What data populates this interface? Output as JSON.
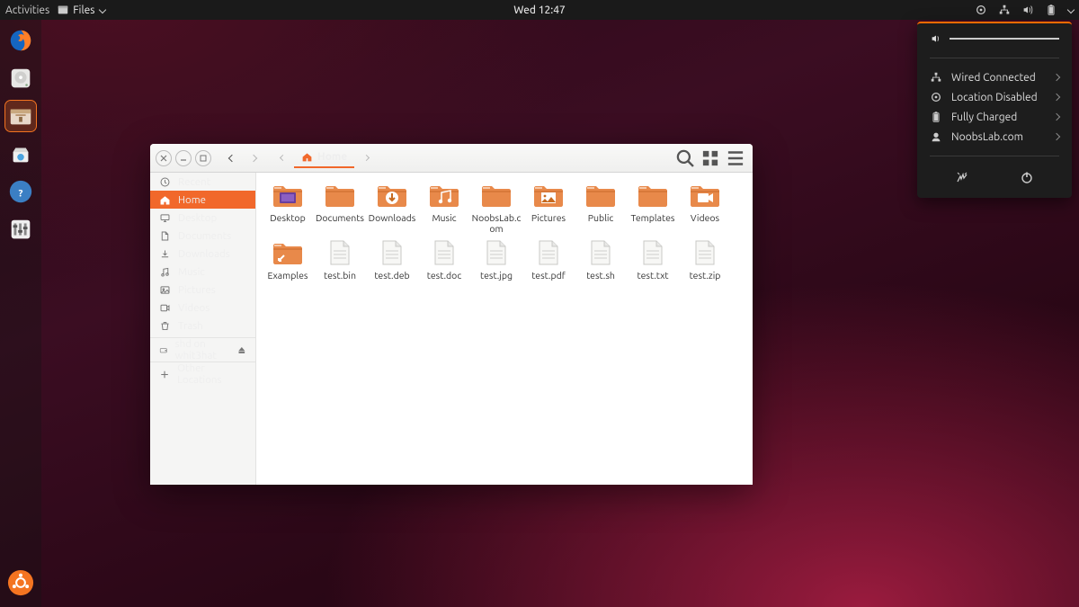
{
  "topbar": {
    "activities": "Activities",
    "app": "Files",
    "clock": "Wed 12:47"
  },
  "system_menu": {
    "rows": [
      {
        "icon": "network",
        "label": "Wired Connected"
      },
      {
        "icon": "location",
        "label": "Location Disabled"
      },
      {
        "icon": "battery",
        "label": "Fully Charged"
      },
      {
        "icon": "user",
        "label": "NoobsLab.com"
      }
    ]
  },
  "dock": {
    "items": [
      {
        "name": "firefox",
        "label": "Firefox"
      },
      {
        "name": "disks",
        "label": "Disks"
      },
      {
        "name": "files",
        "label": "Files",
        "running": true
      },
      {
        "name": "software",
        "label": "Software"
      },
      {
        "name": "help",
        "label": "Help"
      },
      {
        "name": "tweaks",
        "label": "Tweaks"
      }
    ]
  },
  "files": {
    "path_label": "Home",
    "sidebar": [
      {
        "icon": "clock",
        "label": "Recent"
      },
      {
        "icon": "home",
        "label": "Home",
        "active": true
      },
      {
        "icon": "desktop",
        "label": "Desktop"
      },
      {
        "icon": "doc",
        "label": "Documents"
      },
      {
        "icon": "download",
        "label": "Downloads"
      },
      {
        "icon": "music",
        "label": "Music"
      },
      {
        "icon": "pic",
        "label": "Pictures"
      },
      {
        "icon": "video",
        "label": "Videos"
      },
      {
        "icon": "trash",
        "label": "Trash"
      }
    ],
    "mount": {
      "label": "shd on whit3hat"
    },
    "other": {
      "label": "Other Locations"
    },
    "items": [
      {
        "type": "folder-desktop",
        "label": "Desktop"
      },
      {
        "type": "folder",
        "label": "Documents"
      },
      {
        "type": "folder-download",
        "label": "Downloads"
      },
      {
        "type": "folder-music",
        "label": "Music"
      },
      {
        "type": "folder",
        "label": "NoobsLab.com"
      },
      {
        "type": "folder-pic",
        "label": "Pictures"
      },
      {
        "type": "folder",
        "label": "Public"
      },
      {
        "type": "folder",
        "label": "Templates"
      },
      {
        "type": "folder-video",
        "label": "Videos"
      },
      {
        "type": "folder-link",
        "label": "Examples"
      },
      {
        "type": "file",
        "label": "test.bin"
      },
      {
        "type": "file",
        "label": "test.deb"
      },
      {
        "type": "file",
        "label": "test.doc"
      },
      {
        "type": "file",
        "label": "test.jpg"
      },
      {
        "type": "file",
        "label": "test.pdf"
      },
      {
        "type": "file",
        "label": "test.sh"
      },
      {
        "type": "file",
        "label": "test.txt"
      },
      {
        "type": "file",
        "label": "test.zip"
      }
    ]
  }
}
